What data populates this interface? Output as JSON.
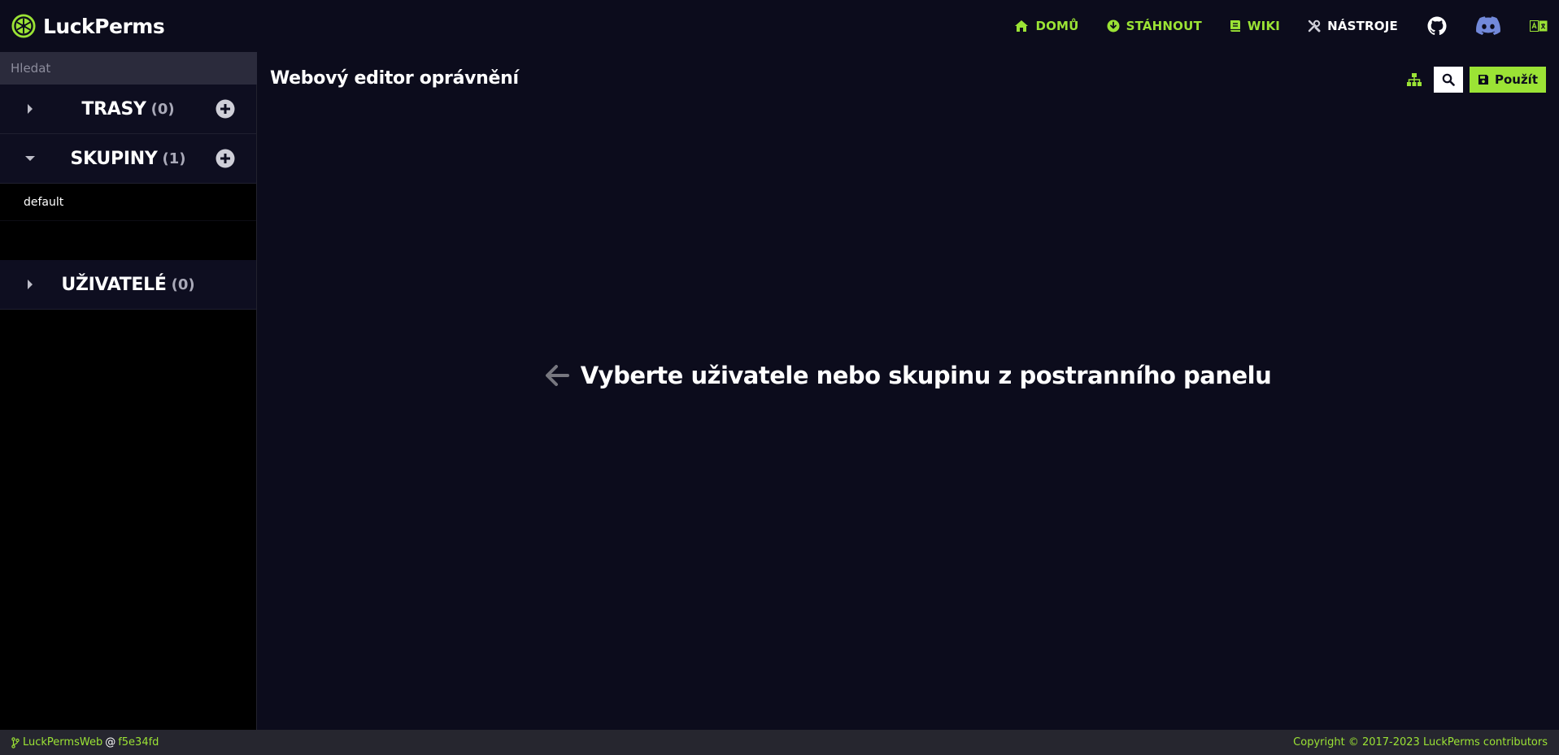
{
  "brand": {
    "name": "LuckPerms"
  },
  "nav": {
    "items": [
      {
        "label": "DOMŮ",
        "icon": "home-icon"
      },
      {
        "label": "STÁHNOUT",
        "icon": "download-icon"
      },
      {
        "label": "WIKI",
        "icon": "book-icon"
      },
      {
        "label": "NÁSTROJE",
        "icon": "tools-icon"
      }
    ],
    "icons": [
      "github-icon",
      "discord-icon",
      "language-icon"
    ]
  },
  "sidebar": {
    "search_placeholder": "Hledat",
    "sections": [
      {
        "title": "TRASY",
        "count": "(0)",
        "expanded": false
      },
      {
        "title": "SKUPINY",
        "count": "(1)",
        "expanded": true,
        "items": [
          "default"
        ]
      },
      {
        "title": "UŽIVATELÉ",
        "count": "(0)",
        "expanded": false
      }
    ]
  },
  "main": {
    "title": "Webový editor oprávnění",
    "apply_label": "Použít",
    "empty_message": "Vyberte uživatele nebo skupinu z postranního panelu"
  },
  "footer": {
    "repo": "LuckPermsWeb",
    "at": "@",
    "commit": "f5e34fd",
    "copyright": "Copyright © 2017-2023 LuckPerms contributors"
  },
  "colors": {
    "accent": "#9be335",
    "background": "#0c0c1c",
    "sidebar": "#000000",
    "section_header": "#0e0e20",
    "footer": "#26262f",
    "discord": "#7289da"
  }
}
